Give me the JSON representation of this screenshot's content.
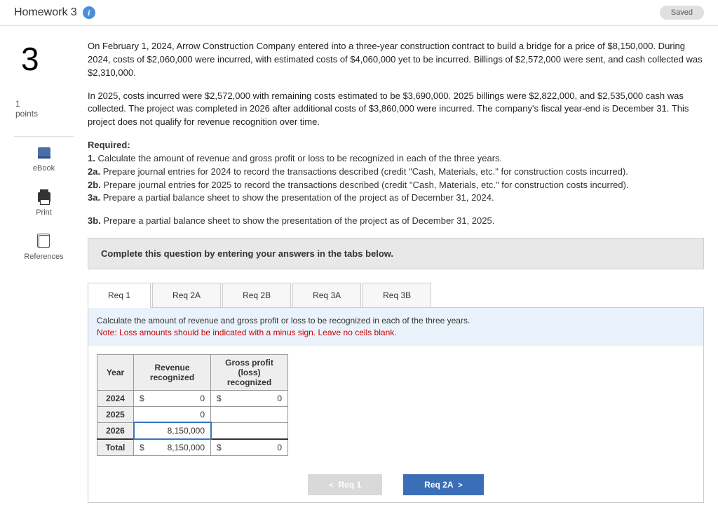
{
  "header": {
    "title": "Homework 3",
    "saved_label": "Saved"
  },
  "sidebar": {
    "question_number": "3",
    "points_value": "1",
    "points_label": "points",
    "actions": {
      "ebook": "eBook",
      "print": "Print",
      "references": "References"
    }
  },
  "question": {
    "para1": "On February 1, 2024, Arrow Construction Company entered into a three-year construction contract to build a bridge for a price of $8,150,000. During 2024, costs of $2,060,000 were incurred, with estimated costs of $4,060,000 yet to be incurred. Billings of $2,572,000 were sent, and cash collected was $2,310,000.",
    "para2": "In 2025, costs incurred were $2,572,000 with remaining costs estimated to be $3,690,000. 2025 billings were $2,822,000, and $2,535,000 cash was collected. The project was completed in 2026 after additional costs of $3,860,000 were incurred. The company's fiscal year-end is December 31. This project does not qualify for revenue recognition over time.",
    "required_head": "Required:",
    "req1": "1. Calculate the amount of revenue and gross profit or loss to be recognized in each of the three years.",
    "req2a": "2a. Prepare journal entries for 2024 to record the transactions described (credit \"Cash, Materials, etc.\" for construction costs incurred).",
    "req2b": "2b. Prepare journal entries for 2025 to record the transactions described (credit \"Cash, Materials, etc.\" for construction costs incurred).",
    "req3a": "3a. Prepare a partial balance sheet to show the presentation of the project as of December 31, 2024.",
    "req3b": "3b. Prepare a partial balance sheet to show the presentation of the project as of December 31, 2025."
  },
  "instruction": "Complete this question by entering your answers in the tabs below.",
  "tabs": {
    "items": [
      "Req 1",
      "Req 2A",
      "Req 2B",
      "Req 3A",
      "Req 3B"
    ],
    "active_index": 0
  },
  "panel": {
    "desc": "Calculate the amount of revenue and gross profit or loss to be recognized in each of the three years.",
    "note": "Note: Loss amounts should be indicated with a minus sign. Leave no cells blank."
  },
  "table": {
    "head_year": "Year",
    "head_rev": "Revenue recognized",
    "head_gp": "Gross profit (loss) recognized",
    "rows": [
      {
        "year": "2024",
        "rev_cur": "$",
        "rev": "0",
        "gp_cur": "$",
        "gp": "0"
      },
      {
        "year": "2025",
        "rev_cur": "",
        "rev": "0",
        "gp_cur": "",
        "gp": ""
      },
      {
        "year": "2026",
        "rev_cur": "",
        "rev": "8,150,000",
        "gp_cur": "",
        "gp": ""
      }
    ],
    "total": {
      "label": "Total",
      "rev_cur": "$",
      "rev": "8,150,000",
      "gp_cur": "$",
      "gp": "0"
    }
  },
  "nav": {
    "prev": "Req 1",
    "next": "Req 2A"
  }
}
